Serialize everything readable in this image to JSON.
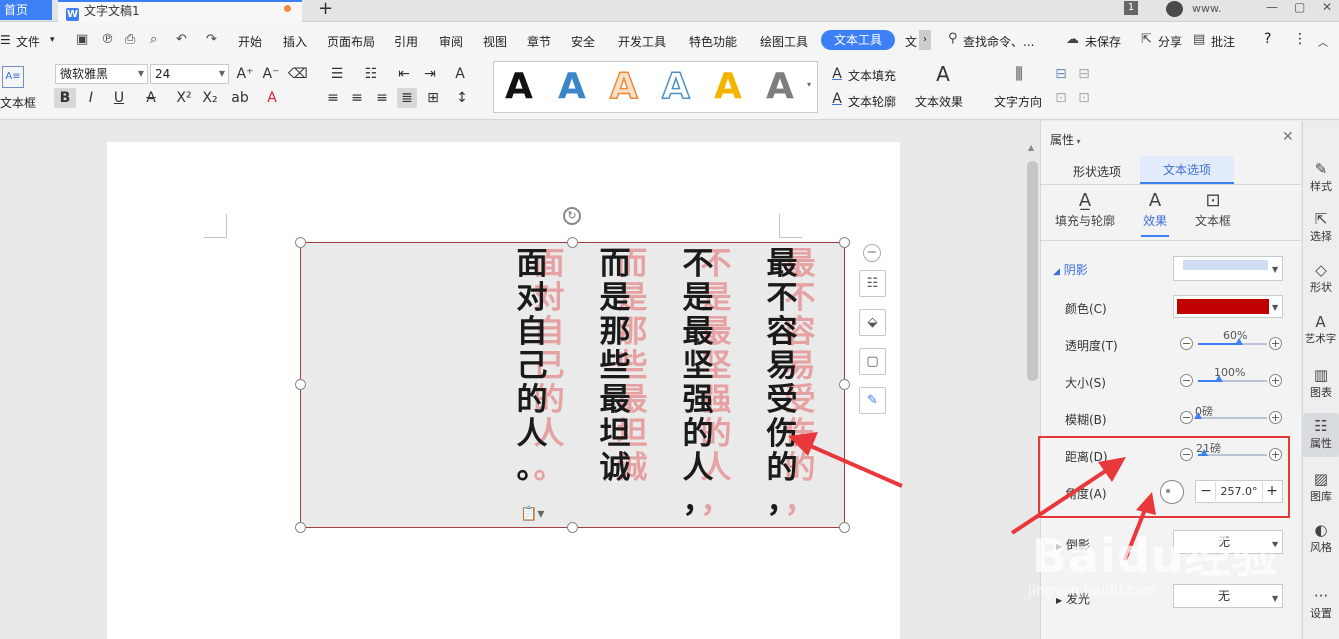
{
  "tabs": {
    "home": "首页",
    "doc_title": "文字文稿1",
    "new_tab": "+"
  },
  "titlebar": {
    "window_count": "1",
    "user": "www.",
    "min": "—",
    "max": "▢",
    "close": "✕"
  },
  "menu": {
    "file": "文件",
    "items": [
      "开始",
      "插入",
      "页面布局",
      "引用",
      "审阅",
      "视图",
      "章节",
      "安全",
      "开发工具",
      "特色功能",
      "绘图工具",
      "文本工具",
      "文"
    ],
    "search": "查找命令、...",
    "unsaved": "未保存",
    "share": "分享",
    "comment": "批注",
    "help": "?",
    "more": "⋮"
  },
  "ribbon": {
    "textbox_label": "文本框",
    "font_name": "微软雅黑",
    "font_size": "24",
    "gallery_glyph": "A",
    "text_fill": "文本填充",
    "text_outline": "文本轮廓",
    "text_effect": "文本效果",
    "text_direction": "文字方向"
  },
  "document": {
    "columns": [
      {
        "main": "最\n不\n容\n易\n受\n伤\n的\n，"
      },
      {
        "main": "不\n是\n最\n坚\n强\n的\n人\n，"
      },
      {
        "main": "而\n是\n那\n些\n最\n坦\n诚"
      },
      {
        "main": "面\n对\n自\n己\n的\n人\n。"
      }
    ]
  },
  "pane": {
    "title": "属性",
    "tab_shape": "形状选项",
    "tab_text": "文本选项",
    "subtabs": [
      "填充与轮廓",
      "效果",
      "文本框"
    ],
    "section_shadow": "阴影",
    "color_label": "颜色(C)",
    "transparency_label": "透明度(T)",
    "transparency_value": "60%",
    "transparency_pct": 60,
    "size_label": "大小(S)",
    "size_value": "100%",
    "size_pct": 30,
    "blur_label": "模糊(B)",
    "blur_value": "0磅",
    "blur_pct": 0,
    "distance_label": "距离(D)",
    "distance_value": "21磅",
    "distance_pct": 8,
    "angle_label": "角度(A)",
    "angle_value": "257.0°",
    "reflection_label": "倒影",
    "reflection_value": "无",
    "glow_label": "发光",
    "glow_value": "无",
    "shadow_color": "#c00000"
  },
  "right_toolbar": [
    "样式",
    "选择",
    "形状",
    "艺术字",
    "图表",
    "属性",
    "图库",
    "风格",
    "设置"
  ],
  "watermark": {
    "brand": "Baidu经验",
    "url": "jingyan.baidu.com"
  }
}
